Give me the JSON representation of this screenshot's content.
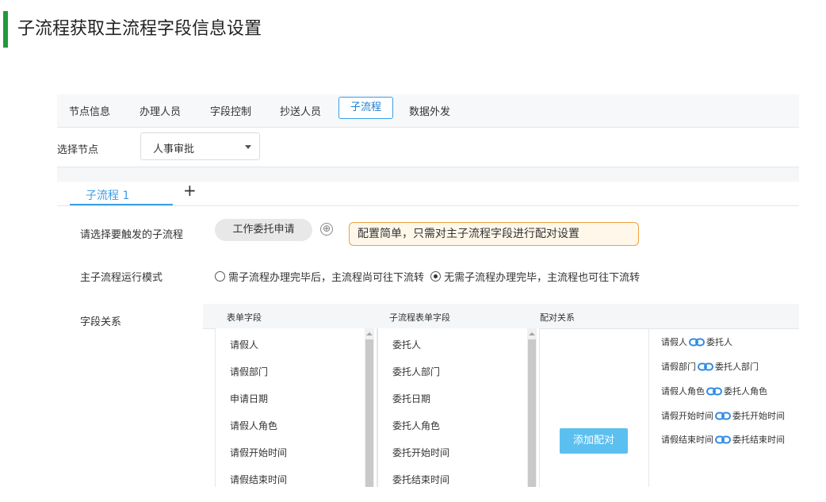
{
  "page_title": "子流程获取主流程字段信息设置",
  "tabs": [
    {
      "label": "节点信息"
    },
    {
      "label": "办理人员"
    },
    {
      "label": "字段控制"
    },
    {
      "label": "抄送人员"
    },
    {
      "label": "子流程"
    },
    {
      "label": "数据外发"
    }
  ],
  "node_select": {
    "label": "选择节点",
    "value": "人事审批"
  },
  "subtab": {
    "label": "子流程 1",
    "add": "+"
  },
  "trigger": {
    "label": "请选择要触发的子流程",
    "button": "工作委托申请",
    "add_icon": "⊕",
    "tip": "配置简单，只需对主子流程字段进行配对设置"
  },
  "run_mode": {
    "label": "主子流程运行模式",
    "option1": "需子流程办理完毕后，主流程尚可往下流转",
    "option2": "无需子流程办理完毕，主流程也可往下流转"
  },
  "field_relation": {
    "label": "字段关系",
    "headers": {
      "form_field": "表单字段",
      "sub_field": "子流程表单字段",
      "pairing": "配对关系"
    },
    "form_fields": [
      "请假人",
      "请假部门",
      "申请日期",
      "请假人角色",
      "请假开始时间",
      "请假结束时间"
    ],
    "sub_fields": [
      "委托人",
      "委托人部门",
      "委托日期",
      "委托人角色",
      "委托开始时间",
      "委托结束时间"
    ],
    "add_pair_button": "添加配对",
    "pairs": [
      {
        "left": "请假人",
        "right": "委托人"
      },
      {
        "left": "请假部门",
        "right": "委托人部门"
      },
      {
        "left": "请假人角色",
        "right": "委托人角色"
      },
      {
        "left": "请假开始时间",
        "right": "委托开始时间"
      },
      {
        "left": "请假结束时间",
        "right": "委托结束时间"
      }
    ]
  },
  "colors": {
    "accent": "#3b9ee8",
    "title_bar": "#1f9a3a",
    "tip_border": "#f0a040",
    "pair_button": "#5bc0f0"
  }
}
